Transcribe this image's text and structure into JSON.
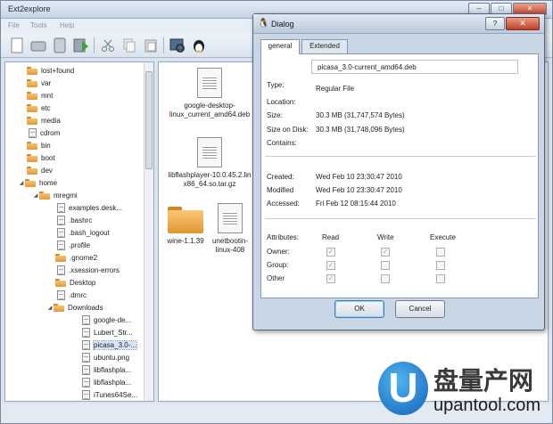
{
  "window": {
    "title": "Ext2explore",
    "controls": {
      "minimize": "–",
      "maximize": "□",
      "close": "✕"
    }
  },
  "menu": [
    "File",
    "Tools",
    "Help"
  ],
  "toolbar": {
    "buttons": [
      "new-icon",
      "drive-icon",
      "disk-icon",
      "save-icon",
      "cut-icon",
      "copy-icon",
      "paste-icon",
      "properties-icon",
      "tux-icon"
    ]
  },
  "tree": [
    {
      "label": "lost+found",
      "icon": "folder"
    },
    {
      "label": "var",
      "icon": "folder"
    },
    {
      "label": "mnt",
      "icon": "folder"
    },
    {
      "label": "etc",
      "icon": "folder"
    },
    {
      "label": "media",
      "icon": "folder"
    },
    {
      "label": "cdrom",
      "icon": "file"
    },
    {
      "label": "bin",
      "icon": "folder"
    },
    {
      "label": "boot",
      "icon": "folder"
    },
    {
      "label": "dev",
      "icon": "folder"
    },
    {
      "label": "home",
      "icon": "folder",
      "expanded": true
    },
    {
      "label": "mregmi",
      "icon": "folder",
      "expanded": true
    },
    {
      "label": "examples.desk...",
      "icon": "file"
    },
    {
      "label": ".bashrc",
      "icon": "file"
    },
    {
      "label": ".bash_logout",
      "icon": "file"
    },
    {
      "label": ".profile",
      "icon": "file"
    },
    {
      "label": ".gnome2",
      "icon": "folder"
    },
    {
      "label": ".xsession-errors",
      "icon": "file"
    },
    {
      "label": "Desktop",
      "icon": "folder"
    },
    {
      "label": ".dmrc",
      "icon": "file"
    },
    {
      "label": "Downloads",
      "icon": "folder",
      "expanded": true
    },
    {
      "label": "google-de...",
      "icon": "file"
    },
    {
      "label": "Lubert_Str...",
      "icon": "file"
    },
    {
      "label": "picasa_3.0-...",
      "icon": "file",
      "selected": true
    },
    {
      "label": "ubuntu.png",
      "icon": "file"
    },
    {
      "label": "libflashpla...",
      "icon": "file"
    },
    {
      "label": "libflashpla...",
      "icon": "file"
    },
    {
      "label": "iTunes64Se...",
      "icon": "file"
    }
  ],
  "files": [
    {
      "line1": "google-desktop-",
      "line2": "linux_current_amd64.deb",
      "icon": "doc"
    },
    {
      "line1": "libflashplayer-10.0.45.2.lin",
      "line2": "x86_64.so.tar.gz",
      "icon": "doc"
    },
    {
      "line1": "wine-1.1.39",
      "line2": "",
      "icon": "folder"
    },
    {
      "line1": "unetbootin-",
      "line2": "linux-408",
      "icon": "doc"
    }
  ],
  "dialog": {
    "title": "Dialog",
    "help": "?",
    "close": "✕",
    "tabs": [
      "general",
      "Extended"
    ],
    "name": "picasa_3.0-current_amd64.deb",
    "labels": {
      "type": "Type:",
      "location": "Location:",
      "size": "Size:",
      "size_on_disk": "Size on Disk:",
      "contains": "Contains:",
      "created": "Created:",
      "modified": "Modified",
      "accessed": "Accessed:"
    },
    "values": {
      "type": "Regular File",
      "size": "30.3 MB (31,747,574 Bytes)",
      "size_on_disk": "30.3 MB (31,748,096 Bytes)",
      "created": "Wed Feb 10 23:30:47 2010",
      "modified": "Wed Feb 10 23:30:47 2010",
      "accessed": "Fri Feb 12 08:15:44 2010"
    },
    "attributes": {
      "header": "Attributes:",
      "columns": [
        "Read",
        "Write",
        "Execute"
      ],
      "rows": [
        {
          "label": "Owner:",
          "read": true,
          "write": true,
          "execute": false
        },
        {
          "label": "Group:",
          "read": true,
          "write": false,
          "execute": false
        },
        {
          "label": "Other",
          "read": true,
          "write": false,
          "execute": false
        }
      ]
    },
    "ok": "OK",
    "cancel": "Cancel"
  },
  "watermark": {
    "logo_letter": "U",
    "cn_text": "盘量产网",
    "url": "upantool.com"
  }
}
